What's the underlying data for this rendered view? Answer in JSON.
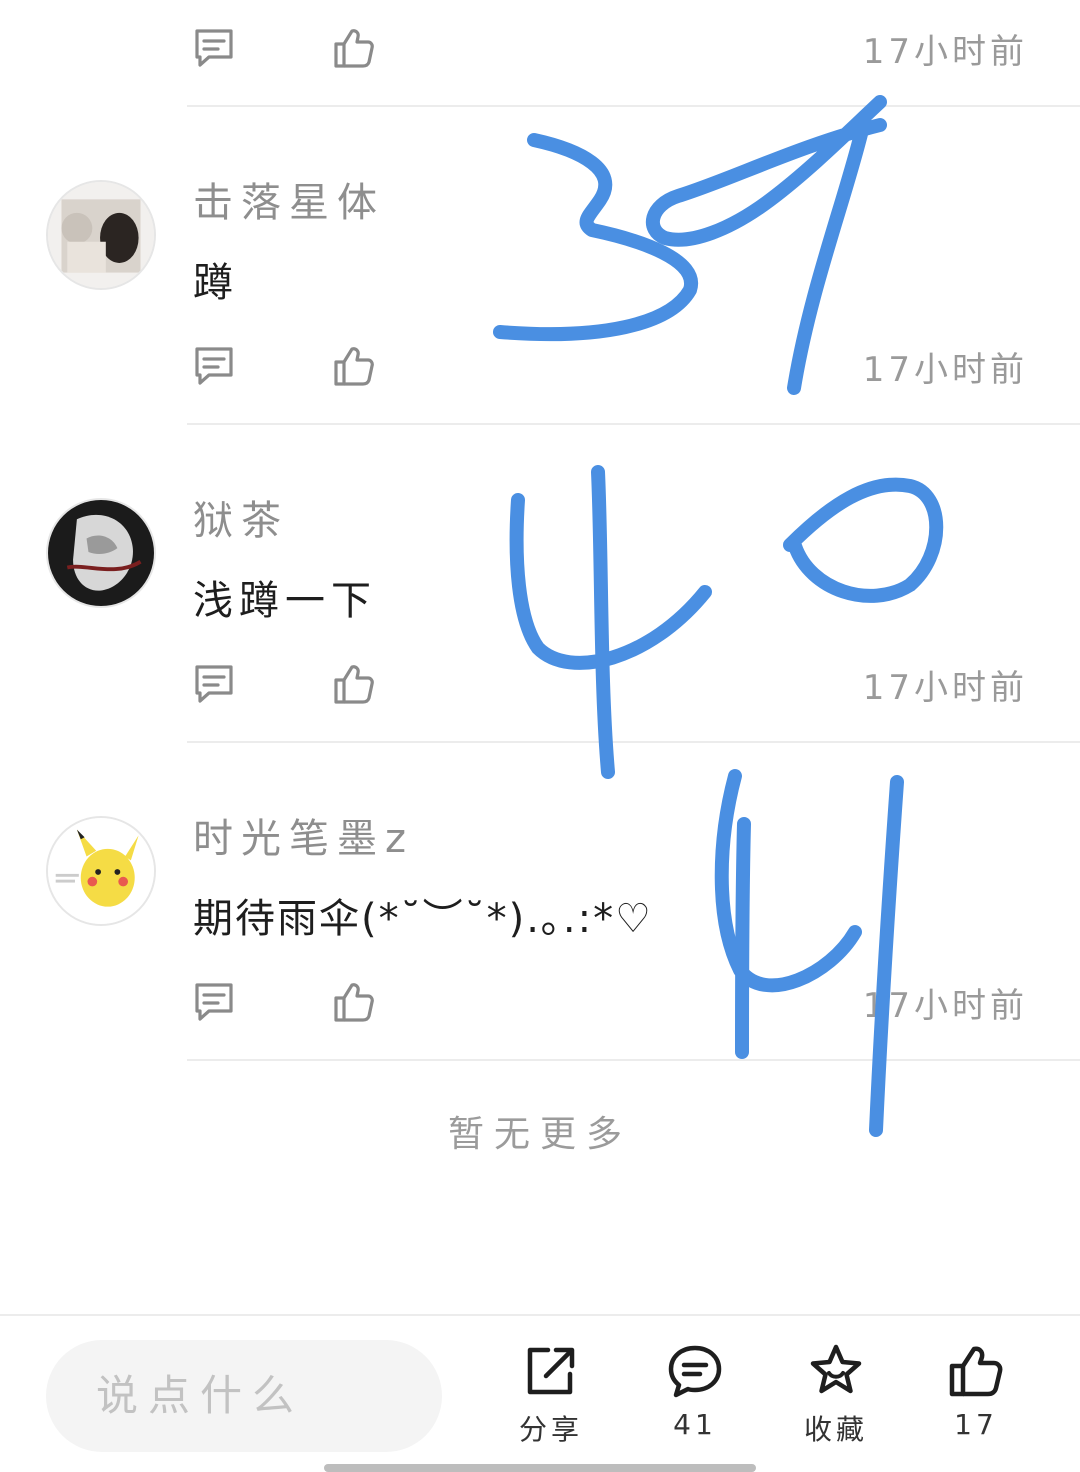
{
  "comments": [
    {
      "username": "",
      "content": "",
      "time": "17小时前"
    },
    {
      "username": "击落星体",
      "content": "蹲",
      "time": "17小时前"
    },
    {
      "username": "狱茶",
      "content": "浅蹲一下",
      "time": "17小时前"
    },
    {
      "username": "时光笔墨z",
      "content": "期待雨伞(*˘︶˘*).｡.:*♡",
      "time": "17小时前"
    }
  ],
  "no_more_text": "暂无更多",
  "bottom_bar": {
    "input_placeholder": "说点什么",
    "share_label": "分享",
    "comment_count": "41",
    "favorite_label": "收藏",
    "like_count": "17"
  },
  "annotations": [
    "39",
    "40",
    "41"
  ],
  "colors": {
    "annotation_ink": "#4a8fe2",
    "text_muted": "#8e8e8e",
    "divider": "#ececec",
    "icon_gray": "#8a8a8a"
  },
  "icons": {
    "reply": "comment-bubble-icon",
    "like": "thumbs-up-icon",
    "share": "share-icon",
    "comment": "comment-icon",
    "favorite": "star-icon"
  }
}
